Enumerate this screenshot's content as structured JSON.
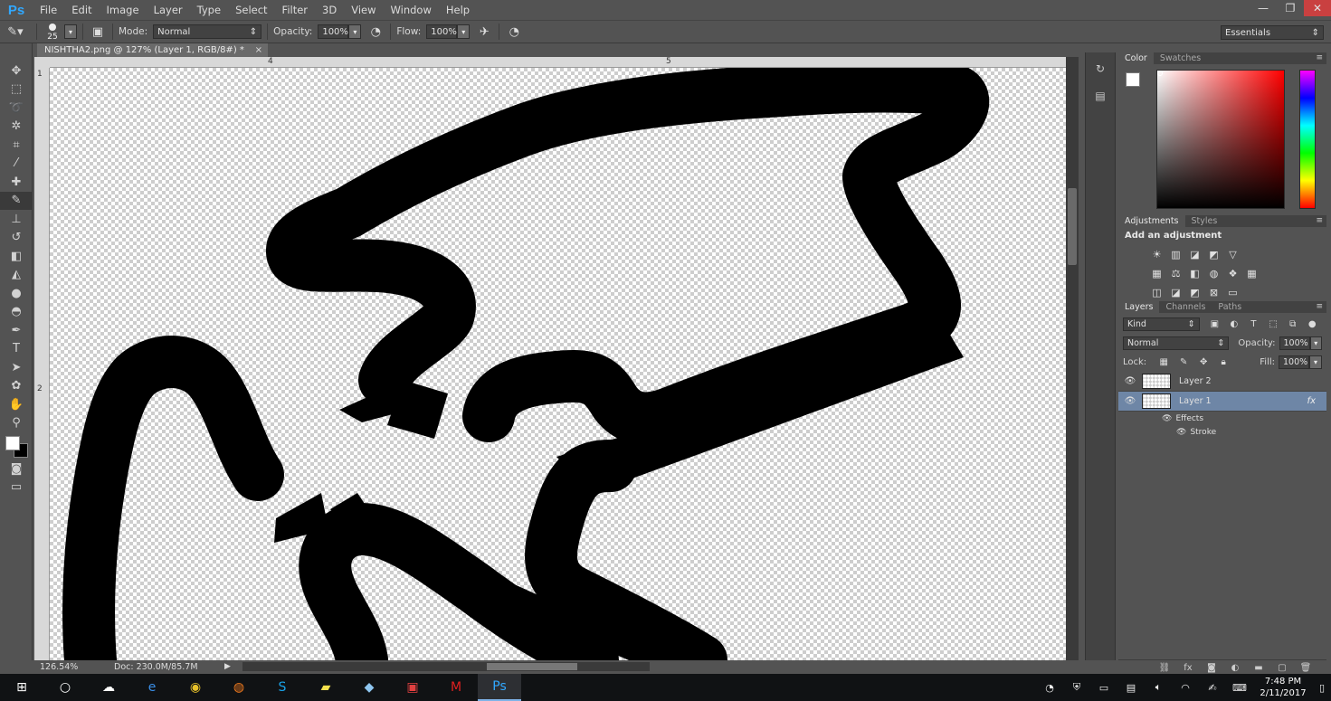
{
  "app": {
    "logo": "Ps",
    "menu": [
      "File",
      "Edit",
      "Image",
      "Layer",
      "Type",
      "Select",
      "Filter",
      "3D",
      "View",
      "Window",
      "Help"
    ],
    "window_controls": {
      "minimize": "—",
      "restore": "❐",
      "close": "✕"
    }
  },
  "options_bar": {
    "brush_size": "25",
    "mode_label": "Mode:",
    "mode_value": "Normal",
    "opacity_label": "Opacity:",
    "opacity_value": "100%",
    "flow_label": "Flow:",
    "flow_value": "100%",
    "workspace": "Essentials"
  },
  "document": {
    "tab_title": "NISHTHA2.png @ 127% (Layer 1, RGB/8#) *",
    "tab_close": "×",
    "ruler_h_ticks": [
      "4",
      "5"
    ],
    "ruler_v_ticks": [
      "1",
      "2"
    ],
    "zoom": "126.54%",
    "doc_size": "Doc: 230.0M/85.7M"
  },
  "color_panel": {
    "tabs": [
      "Color",
      "Swatches"
    ],
    "active_tab": "Color",
    "foreground": "#ffffff",
    "background": "#000000"
  },
  "adjustments_panel": {
    "tabs": [
      "Adjustments",
      "Styles"
    ],
    "title": "Add an adjustment"
  },
  "layers_panel": {
    "tabs": [
      "Layers",
      "Channels",
      "Paths"
    ],
    "filter_kind": "Kind",
    "blend_mode": "Normal",
    "opacity_label": "Opacity:",
    "opacity_value": "100%",
    "lock_label": "Lock:",
    "fill_label": "Fill:",
    "fill_value": "100%",
    "layers": [
      {
        "name": "Layer 2",
        "selected": false,
        "fx": ""
      },
      {
        "name": "Layer 1",
        "selected": true,
        "fx": "fx"
      }
    ],
    "effects_label": "Effects",
    "effect_items": [
      "Stroke"
    ]
  },
  "taskbar": {
    "time": "7:48 PM",
    "date": "2/11/2017"
  }
}
